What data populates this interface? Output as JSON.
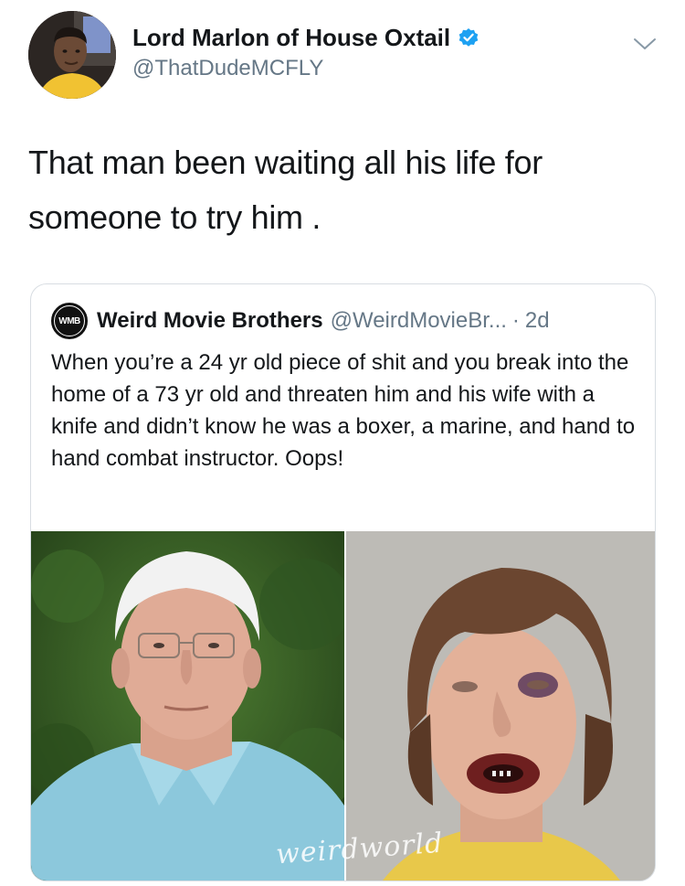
{
  "tweet": {
    "author": {
      "display_name": "Lord Marlon of House Oxtail",
      "handle": "@ThatDudeMCFLY",
      "verified": true
    },
    "text_lines": [
      "That man been waiting all his life for",
      "someone to try him ."
    ],
    "menu_icon": "chevron-down-icon"
  },
  "quote": {
    "author": {
      "avatar_text": "WMB",
      "display_name": "Weird Movie Brothers",
      "handle": "@WeirdMovieBr...",
      "separator": "·",
      "time": "2d"
    },
    "text": "When you’re a 24 yr old piece of shit and you break into the home of a 73 yr old and threaten him and his wife with a knife and didn’t know he was a boxer, a marine, and hand to hand combat instructor. Oops!",
    "media": {
      "watermark": "weirdworld"
    }
  },
  "colors": {
    "text_primary": "#14171a",
    "text_secondary": "#657786",
    "verified_blue": "#1da1f2",
    "border": "#d8dde2"
  }
}
